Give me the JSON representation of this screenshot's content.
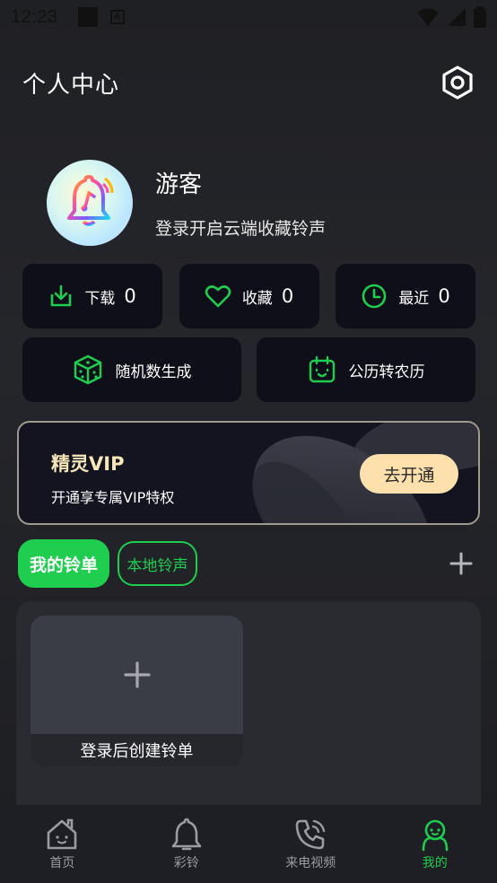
{
  "status_bar": {
    "time": "12:23",
    "a_badge": "A"
  },
  "header": {
    "title": "个人中心"
  },
  "profile": {
    "username": "游客",
    "hint": "登录开启云端收藏铃声"
  },
  "stats": [
    {
      "label": "下载",
      "count": "0",
      "icon": "download-icon"
    },
    {
      "label": "收藏",
      "count": "0",
      "icon": "heart-icon"
    },
    {
      "label": "最近",
      "count": "0",
      "icon": "clock-icon"
    }
  ],
  "tools": [
    {
      "label": "随机数生成",
      "icon": "dice-icon"
    },
    {
      "label": "公历转农历",
      "icon": "calendar-icon"
    }
  ],
  "vip": {
    "title": "精灵VIP",
    "subtitle": "开通享专属VIP特权",
    "button": "去开通"
  },
  "tabs": {
    "active": "我的铃单",
    "inactive": "本地铃声"
  },
  "playlist": {
    "create_label": "登录后创建铃单"
  },
  "nav": [
    {
      "label": "首页",
      "icon": "home-icon"
    },
    {
      "label": "彩铃",
      "icon": "bell-icon"
    },
    {
      "label": "来电视频",
      "icon": "phone-icon"
    },
    {
      "label": "我的",
      "icon": "user-icon",
      "active": true
    }
  ],
  "colors": {
    "accent": "#1fcd4f",
    "vip_gold": "#f6e6b8",
    "vip_button": "#fde0ac",
    "card_bg": "#0f0f1a"
  }
}
